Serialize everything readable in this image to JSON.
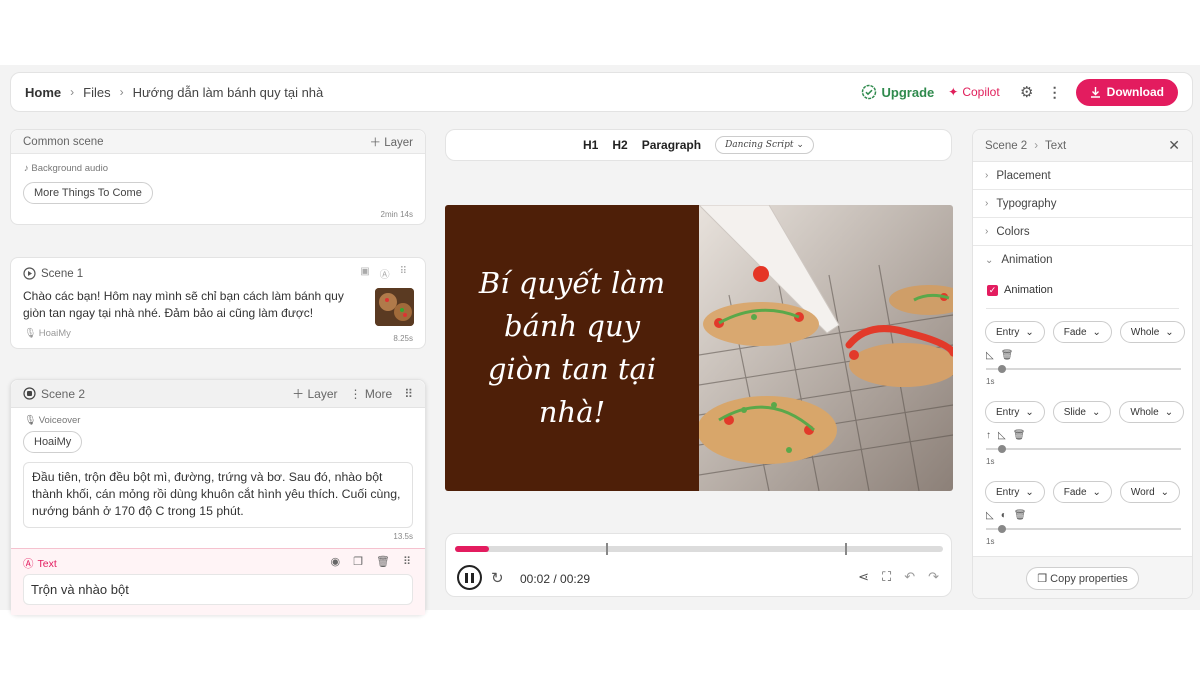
{
  "breadcrumb": {
    "home": "Home",
    "files": "Files",
    "current": "Hướng dẫn làm bánh quy tại nhà"
  },
  "topbar": {
    "upgrade": "Upgrade",
    "copilot": "Copilot",
    "download": "Download"
  },
  "common": {
    "title": "Common scene",
    "add_layer": "Layer",
    "audio_label": "Background audio",
    "audio_track": "More Things To Come",
    "duration": "2min 14s"
  },
  "scene1": {
    "title": "Scene 1",
    "text": "Chào các bạn! Hôm nay mình sẽ chỉ bạn cách làm bánh quy giòn tan ngay tại nhà nhé. Đảm bảo ai cũng làm được!",
    "voice": "HoaiMy",
    "duration": "8.25s"
  },
  "scene2": {
    "title": "Scene 2",
    "add_layer": "Layer",
    "more": "More",
    "voiceover_label": "Voiceover",
    "voice": "HoaiMy",
    "script": "Đầu tiên, trộn đều bột mì, đường, trứng và bơ. Sau đó, nhào bột thành khối, cán mỏng rồi dùng khuôn cắt hình yêu thích. Cuối cùng, nướng bánh ở 170 độ C trong 15 phút.",
    "duration": "13.5s",
    "text_layer_label": "Text",
    "text_layer_value": "Trộn và nhào bột"
  },
  "format": {
    "h1": "H1",
    "h2": "H2",
    "paragraph": "Paragraph",
    "font": "Dancing Script"
  },
  "preview": {
    "headline": "Bí quyết làm bánh quy giòn tan tại nhà!"
  },
  "player": {
    "time": "00:02 / 00:29",
    "progress": 0.069,
    "markers": [
      0.31,
      0.8
    ]
  },
  "panel": {
    "crumb_scene": "Scene 2",
    "crumb_item": "Text",
    "sections": [
      "Placement",
      "Typography",
      "Colors",
      "Animation"
    ],
    "animation_checkbox": "Animation",
    "rows": [
      {
        "dir": "Entry",
        "effect": "Fade",
        "unit": "Whole",
        "dur": "1s"
      },
      {
        "dir": "Entry",
        "effect": "Slide",
        "unit": "Whole",
        "dur": "1s"
      },
      {
        "dir": "Entry",
        "effect": "Fade",
        "unit": "Word",
        "dur": "1s"
      }
    ],
    "copy": "Copy properties"
  },
  "colors": {
    "accent": "#e31c5f",
    "upgrade": "#2f8a4d",
    "preview_bg": "#4e1f08"
  }
}
